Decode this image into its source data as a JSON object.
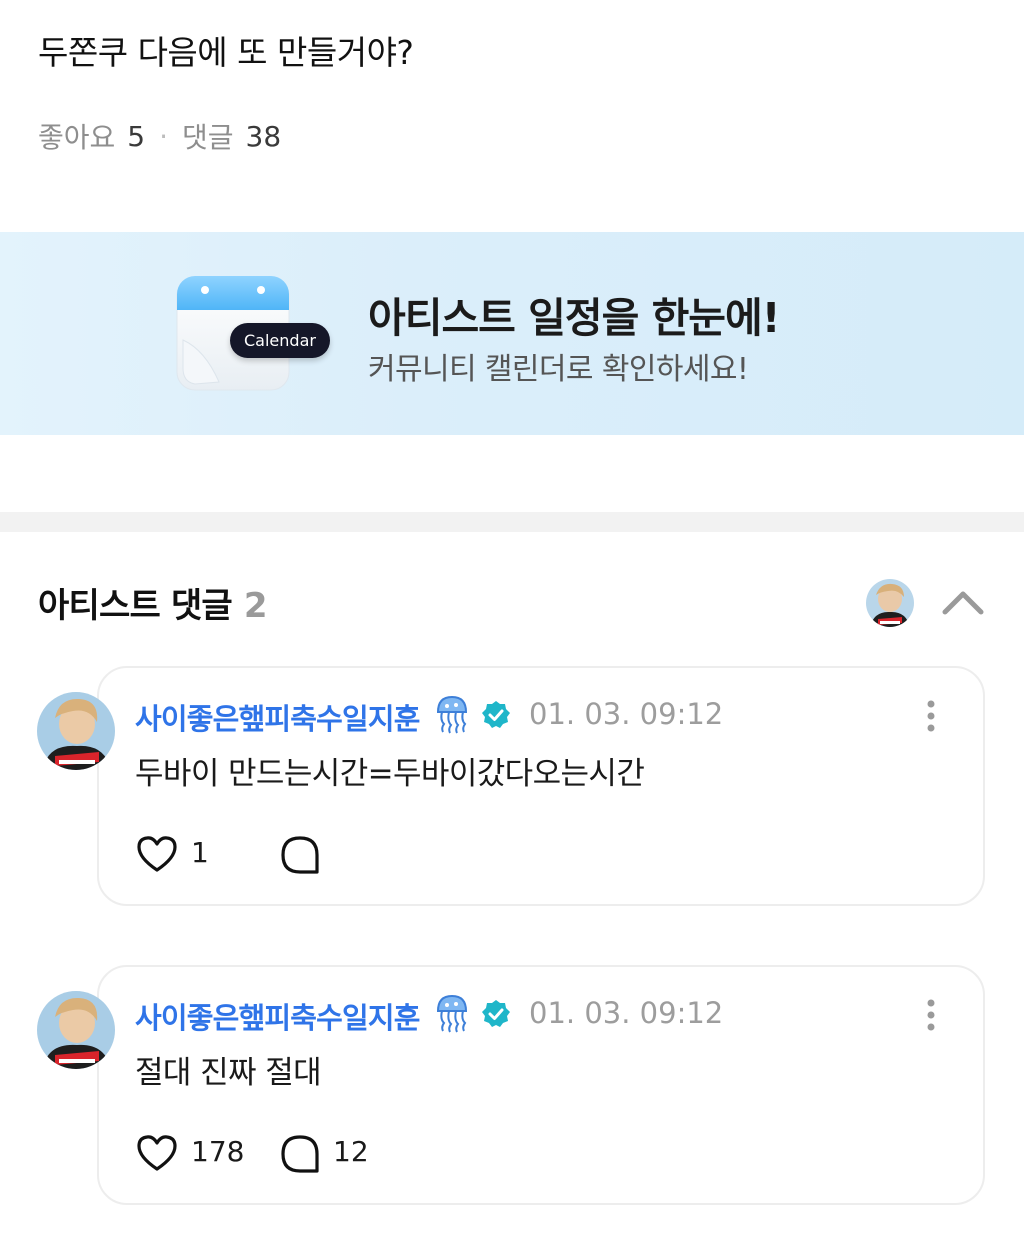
{
  "post": {
    "text": "두쫀쿠 다음에 또 만들거야?",
    "likes_label": "좋아요",
    "likes_count": "5",
    "comments_label": "댓글",
    "comments_count": "38"
  },
  "banner": {
    "pill_label": "Calendar",
    "title": "아티스트 일정을 한눈에!",
    "subtitle": "커뮤니티 캘린더로 확인하세요!",
    "icon": "calendar-icon"
  },
  "artist_comments": {
    "title": "아티스트 댓글",
    "count": "2",
    "items": [
      {
        "author": "사이좋은햎피축수일지훈",
        "timestamp": "01. 03. 09:12",
        "body": "두바이 만드는시간=두바이갔다오는시간",
        "likes": "1",
        "replies": ""
      },
      {
        "author": "사이좋은햎피축수일지훈",
        "timestamp": "01. 03. 09:12",
        "body": "절대 진짜 절대",
        "likes": "178",
        "replies": "12"
      }
    ]
  },
  "colors": {
    "accent_blue": "#2f74e8",
    "verified": "#1fb6c9",
    "banner_bg": "#dbeefa"
  }
}
